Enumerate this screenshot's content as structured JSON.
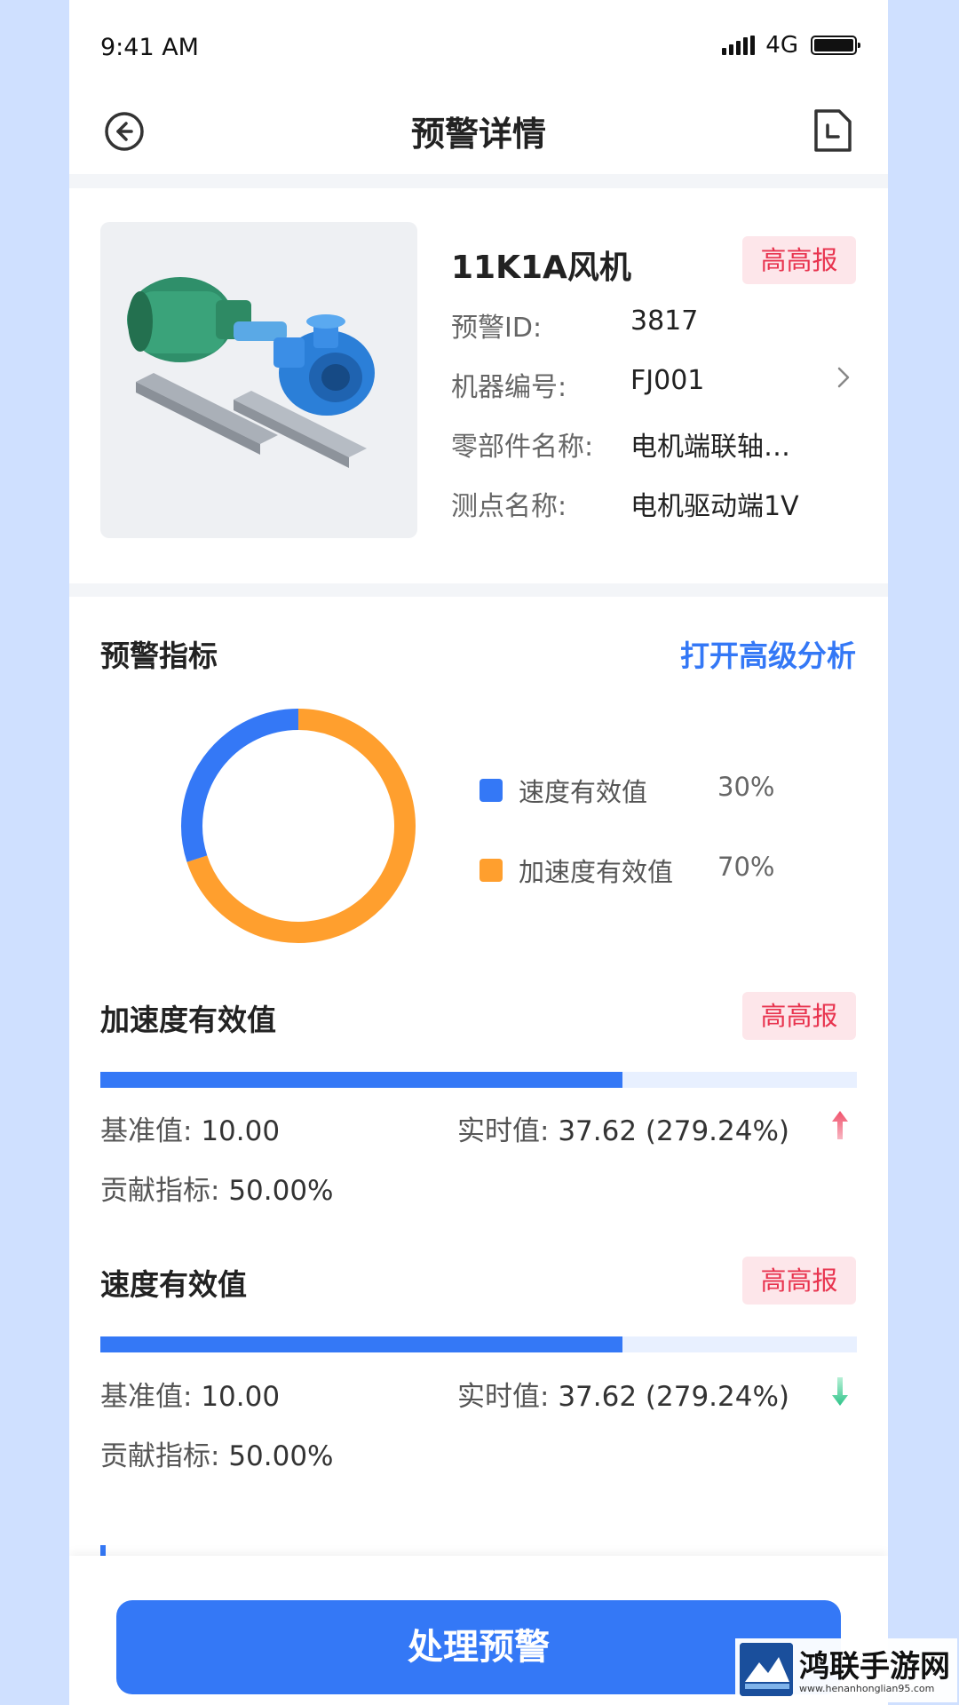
{
  "status_bar": {
    "time": "9:41 AM",
    "network": "4G"
  },
  "nav": {
    "title": "预警详情"
  },
  "device": {
    "name": "11K1A风机",
    "level_badge": "高高报",
    "fields": [
      {
        "label": "预警ID:",
        "value": "3817"
      },
      {
        "label": "机器编号:",
        "value": "FJ001"
      },
      {
        "label": "零部件名称:",
        "value": "电机端联轴…"
      },
      {
        "label": "测点名称:",
        "value": "电机驱动端1V"
      }
    ]
  },
  "indicators": {
    "title": "预警指标",
    "advanced_link": "打开高级分析",
    "colors": {
      "velocity": "#3478f6",
      "acceleration": "#ff9f2e"
    },
    "chart_data": {
      "type": "pie",
      "categories": [
        "速度有效值",
        "加速度有效值"
      ],
      "values": [
        30,
        70
      ],
      "labels": [
        "30%",
        "70%"
      ]
    }
  },
  "metrics": [
    {
      "name": "加速度有效值",
      "badge": "高高报",
      "progress": 0.69,
      "base_label": "基准值:",
      "base_value": "10.00",
      "realtime_label": "实时值:",
      "realtime_value": "37.62 (279.24%)",
      "trend": "up",
      "contrib_label": "贡献指标:",
      "contrib_value": "50.00%"
    },
    {
      "name": "速度有效值",
      "badge": "高高报",
      "progress": 0.69,
      "base_label": "基准值:",
      "base_value": "10.00",
      "realtime_label": "实时值:",
      "realtime_value": "37.62 (279.24%)",
      "trend": "down",
      "contrib_label": "贡献指标:",
      "contrib_value": "50.00%"
    }
  ],
  "footer": {
    "primary_button": "处理预警"
  },
  "watermark": {
    "title": "鸿联手游网",
    "url": "www.henanhonglian95.com"
  }
}
